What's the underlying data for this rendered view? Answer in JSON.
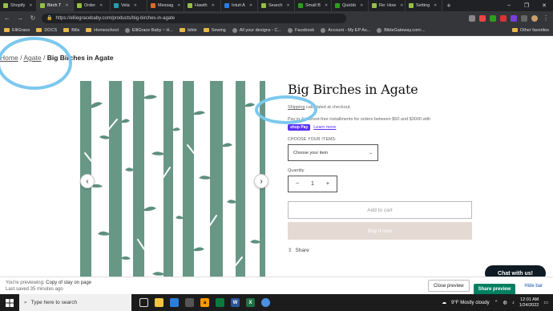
{
  "browser": {
    "tabs": [
      {
        "label": "Shopify",
        "color": "#95bf47",
        "active": false
      },
      {
        "label": "Birch T",
        "color": "#95bf47",
        "active": true
      },
      {
        "label": "Order",
        "color": "#95bf47",
        "active": false
      },
      {
        "label": "Vela",
        "color": "#22a0b0",
        "active": false
      },
      {
        "label": "Messag",
        "color": "#e4682a",
        "active": false
      },
      {
        "label": "Hawth",
        "color": "#95bf47",
        "active": false
      },
      {
        "label": "Intuit A",
        "color": "#2a7de1",
        "active": false
      },
      {
        "label": "Search",
        "color": "#95bf47",
        "active": false
      },
      {
        "label": "Small B",
        "color": "#2ca01c",
        "active": false
      },
      {
        "label": "Quickb",
        "color": "#2ca01c",
        "active": false
      },
      {
        "label": "Re: How",
        "color": "#95bf47",
        "active": false
      },
      {
        "label": "Setting",
        "color": "#95bf47",
        "active": false
      }
    ],
    "url": "https://elliegracebaby.com/products/big-birches-in-agate",
    "bookmarks": [
      "ElliGrace",
      "DOCS",
      "Bills",
      "Homeschool",
      "ElliGrace Baby ~ H...",
      "bible",
      "Sewing",
      "All your designs - C...",
      "Facebook",
      "Account - My EP As...",
      "BibleGateway.com:..."
    ],
    "other_favorites": "Other favorites"
  },
  "breadcrumb": {
    "home": "Home",
    "sep1": "/",
    "collection": "Agate",
    "sep2": "/",
    "current": "Big Birches in Agate"
  },
  "product": {
    "title": "Big Birches in Agate",
    "shipping_link": "Shipping",
    "shipping_text": "calculated at checkout.",
    "installments": "Pay in 4 interest-free installments for orders between $50 and $3000 with",
    "shop_pay": "shop Pay",
    "learn_more": "Learn more",
    "option_label": "CHOOSE YOUR ITEMS:",
    "option_placeholder": "Choose your item",
    "quantity_label": "Quantity",
    "quantity_value": "1",
    "qty_minus": "−",
    "qty_plus": "+",
    "add_to_cart": "Add to cart",
    "buy_now": "Buy it now",
    "share": "Share"
  },
  "gallery": {
    "prev": "‹",
    "next": "›",
    "fabric_color": "#5e8f7e"
  },
  "chat": {
    "label": "Chat with us!"
  },
  "preview_bar": {
    "previewing_prefix": "You're previewing:",
    "theme_name": "Copy of stay on page",
    "last_saved": "Last saved 35 minutes ago",
    "close": "Close preview",
    "share": "Share preview",
    "hide": "Hide bar"
  },
  "taskbar": {
    "search_placeholder": "Type here to search",
    "weather": "9°F  Mostly cloudy",
    "time": "12:01 AM",
    "date": "1/24/2022"
  }
}
